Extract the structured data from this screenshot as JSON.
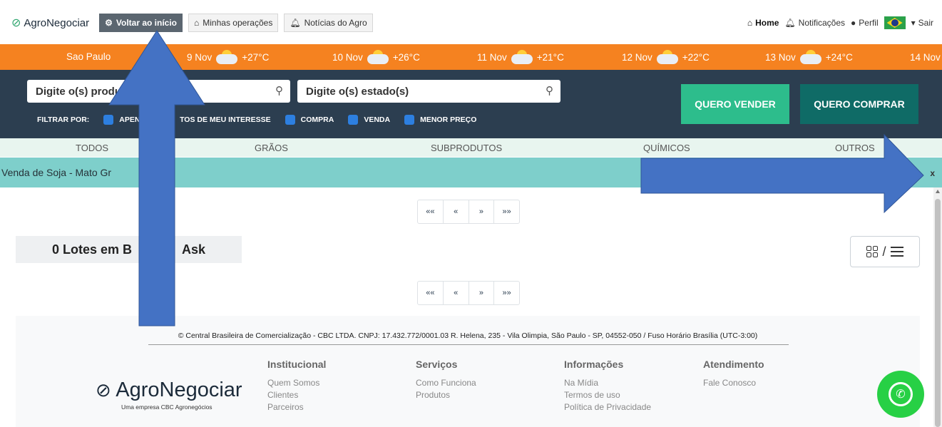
{
  "topnav": {
    "brand": "AgroNegociar",
    "buttons": [
      "Voltar ao início",
      "Minhas operações",
      "Notícias do Agro"
    ],
    "right": {
      "home": "Home",
      "notifications": "Notificações",
      "profile": "Perfil",
      "logout": "Sair"
    }
  },
  "weather": {
    "city": "Sao Paulo",
    "days": [
      {
        "date": "9 Nov",
        "temp": "+27°C"
      },
      {
        "date": "10 Nov",
        "temp": "+26°C"
      },
      {
        "date": "11 Nov",
        "temp": "+21°C"
      },
      {
        "date": "12 Nov",
        "temp": "+22°C"
      },
      {
        "date": "13 Nov",
        "temp": "+24°C"
      },
      {
        "date": "14 Nov",
        "temp": ""
      }
    ]
  },
  "search": {
    "product_placeholder": "Digite o(s) produto(",
    "state_placeholder": "Digite o(s) estado(s)",
    "filter_label": "FILTRAR POR:",
    "filters": [
      "APENA",
      "TOS DE MEU INTERESSE",
      "COMPRA",
      "VENDA",
      "MENOR PREÇO"
    ],
    "sell_button": "QUERO VENDER",
    "buy_button": "QUERO COMPRAR"
  },
  "tabs": [
    "TODOS",
    "GRÃOS",
    "SUBPRODUTOS",
    "QUÍMICOS",
    "OUTROS"
  ],
  "notice": {
    "text": "Venda de Soja - Mato Gr",
    "close": "x"
  },
  "pager": [
    "««",
    "«",
    "»",
    "»»"
  ],
  "lotes": {
    "text": "0 Lotes em B",
    "text2": "Ask"
  },
  "view_toggle": {
    "separator": "/"
  },
  "footer": {
    "copyright": "© Central Brasileira de Comercialização - CBC LTDA. CNPJ: 17.432.772/0001.03 R. Helena, 235 - Vila Olimpia, São Paulo - SP, 04552-050 / Fuso Horário Brasília (UTC-3:00)",
    "logo": "AgroNegociar",
    "tagline": "Uma empresa CBC Agronegócios",
    "columns": [
      {
        "title": "Institucional",
        "links": [
          "Quem Somos",
          "Clientes",
          "Parceiros"
        ]
      },
      {
        "title": "Serviços",
        "links": [
          "Como Funciona",
          "Produtos"
        ]
      },
      {
        "title": "Informações",
        "links": [
          "Na Mídia",
          "Termos de uso",
          "Política de Privacidade"
        ]
      },
      {
        "title": "Atendimento",
        "links": [
          "Fale Conosco"
        ]
      }
    ]
  },
  "colors": {
    "orange": "#f58220",
    "navy": "#2c3e50",
    "teal_notice": "#7ecfcb",
    "sell": "#2dbd8c",
    "buy": "#0f6b66",
    "annotation_blue": "#4472c4"
  }
}
